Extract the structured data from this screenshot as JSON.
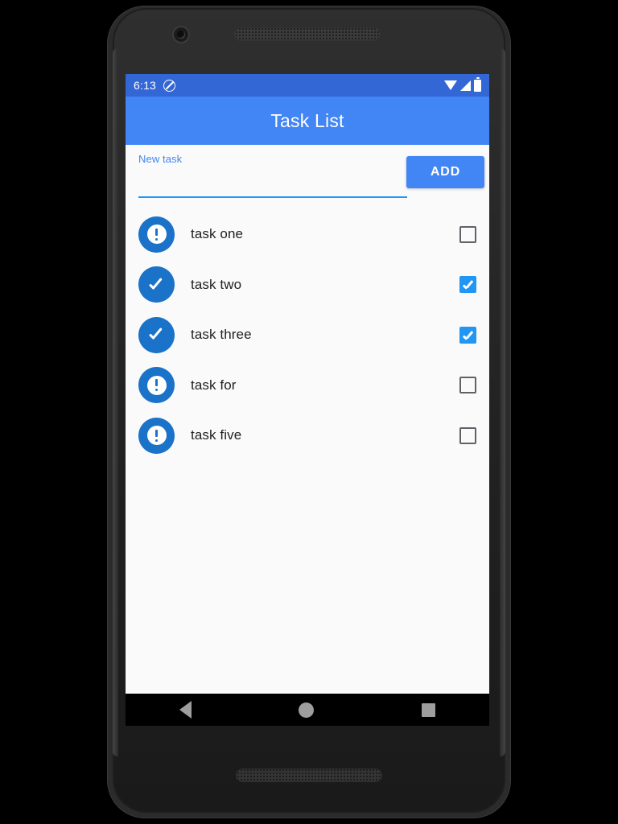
{
  "status_bar": {
    "time": "6:13",
    "icons": [
      "do-not-disturb-icon",
      "wifi-icon",
      "cell-signal-icon",
      "battery-icon"
    ],
    "background_color": "#3367D6"
  },
  "app_bar": {
    "title": "Task List",
    "background_color": "#4285F4"
  },
  "input_row": {
    "label": "New task",
    "value": "",
    "placeholder": "",
    "underline_color": "#2196F3",
    "label_color": "#4285F4",
    "add_label": "ADD",
    "add_color": "#4285F4"
  },
  "tasks": [
    {
      "label": "task one",
      "done": false,
      "status_icon": "exclamation-circle-icon",
      "checkbox": "unchecked"
    },
    {
      "label": "task two",
      "done": true,
      "status_icon": "check-circle-icon",
      "checkbox": "checked"
    },
    {
      "label": "task three",
      "done": true,
      "status_icon": "check-circle-icon",
      "checkbox": "checked"
    },
    {
      "label": "task for",
      "done": false,
      "status_icon": "exclamation-circle-icon",
      "checkbox": "unchecked"
    },
    {
      "label": "task five",
      "done": false,
      "status_icon": "exclamation-circle-icon",
      "checkbox": "unchecked"
    }
  ],
  "nav_bar": {
    "back": "back-triangle-icon",
    "home": "home-circle-icon",
    "recents": "recents-square-icon",
    "background_color": "#000000"
  },
  "theme": {
    "accent": "#4285F4",
    "status_bar": "#3367D6",
    "icon_blue": "#1A73C8",
    "checkbox_blue": "#2196F3",
    "content_bg": "#FAFAFA",
    "text": "#212121"
  }
}
